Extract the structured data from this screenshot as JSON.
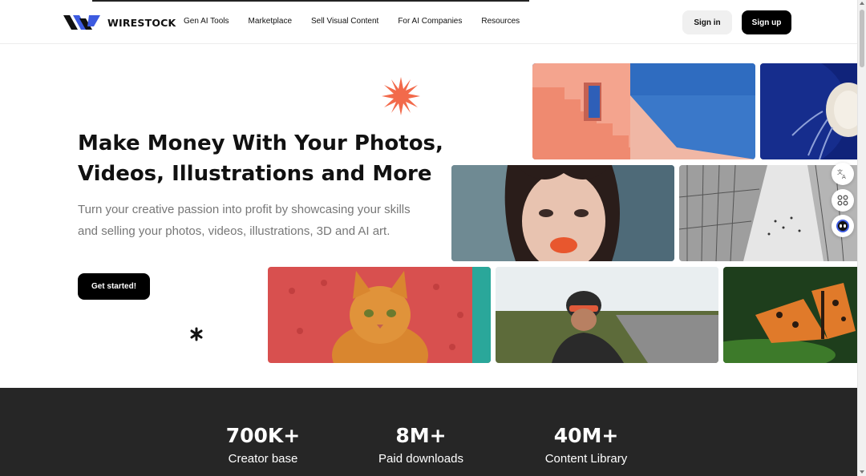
{
  "header": {
    "brand": "WIRESTOCK",
    "nav": [
      "Gen AI Tools",
      "Marketplace",
      "Sell Visual Content",
      "For AI Companies",
      "Resources"
    ],
    "signin_label": "Sign in",
    "signup_label": "Sign up"
  },
  "hero": {
    "title_line1": "Make Money With Your Photos,",
    "title_line2": "Videos, Illustrations and More",
    "subtitle": "Turn your creative passion into profit by showcasing your skills and selling your photos, videos, illustrations, 3D and AI art.",
    "cta_label": "Get started!"
  },
  "stats": [
    {
      "value": "700K+",
      "label": "Creator base"
    },
    {
      "value": "8M+",
      "label": "Paid downloads"
    },
    {
      "value": "40M+",
      "label": "Content Library"
    }
  ],
  "colors": {
    "accent_orange": "#f26a4b",
    "brand_blue": "#3d5be0",
    "dark_band": "#262626"
  },
  "icons": [
    "wirestock-logo-icon",
    "orange-star-icon",
    "asterisk-icon",
    "translate-icon",
    "apps-icon",
    "assistant-icon"
  ]
}
